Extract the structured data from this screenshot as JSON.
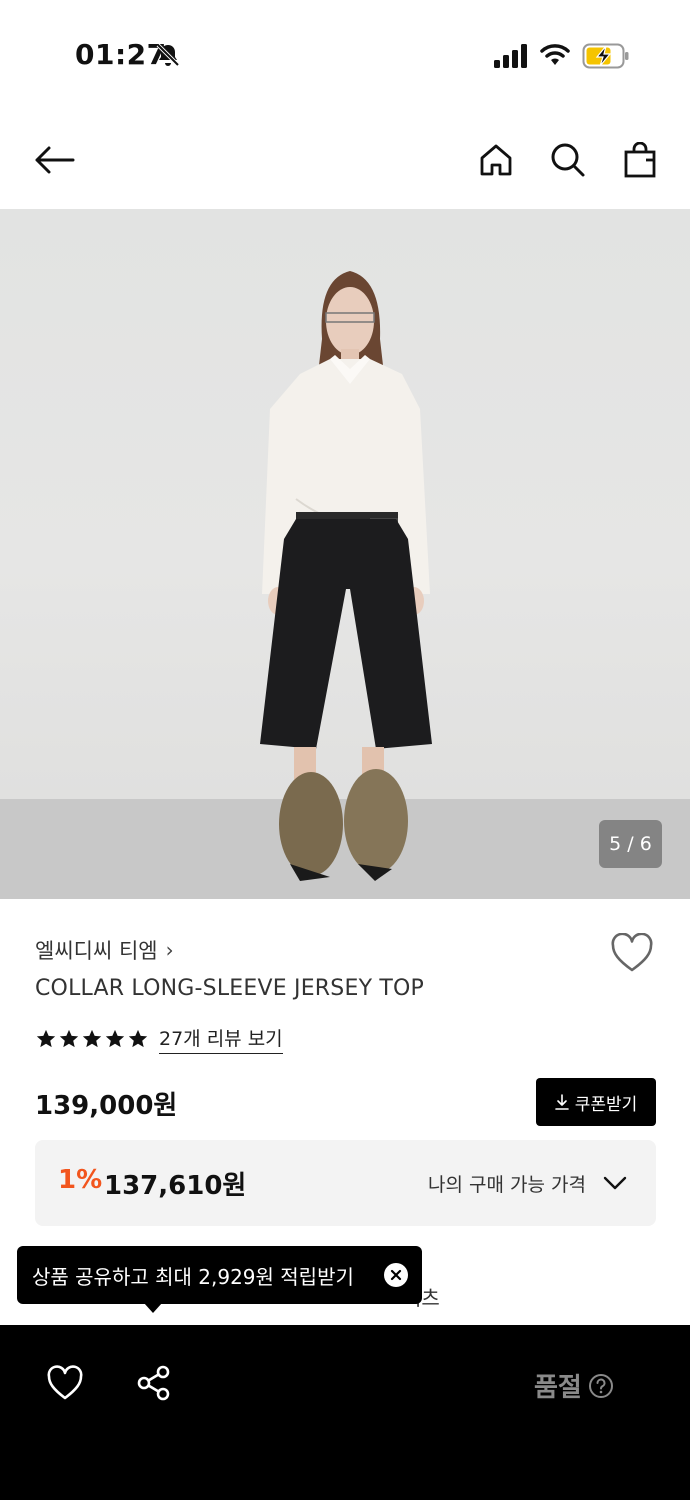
{
  "status_bar": {
    "time": "01:27"
  },
  "nav": {
    "icons": [
      "back-arrow-icon",
      "home-icon",
      "search-icon",
      "shopping-bag-icon"
    ]
  },
  "gallery": {
    "counter": "5 / 6"
  },
  "product": {
    "brand": "엘씨디씨 티엠",
    "brand_chevron": "›",
    "name": "COLLAR LONG-SLEEVE JERSEY TOP",
    "rating_stars": 5,
    "review_link": "27개 리뷰 보기",
    "price": "139,000원",
    "coupon_button": "쿠폰받기",
    "discount_rate": "1%",
    "discount_price": "137,610원",
    "my_price_label": "나의 구매 가능 가격",
    "partial_text": "셔츠"
  },
  "tooltip": {
    "text": "상품 공유하고 최대 2,929원 적립받기"
  },
  "bottom_bar": {
    "status": "품절"
  },
  "colors": {
    "accent_discount": "#f2551d",
    "button_bg": "#000000",
    "bottom_bar_bg": "#000000",
    "soldout_text": "#8a8a8a"
  }
}
